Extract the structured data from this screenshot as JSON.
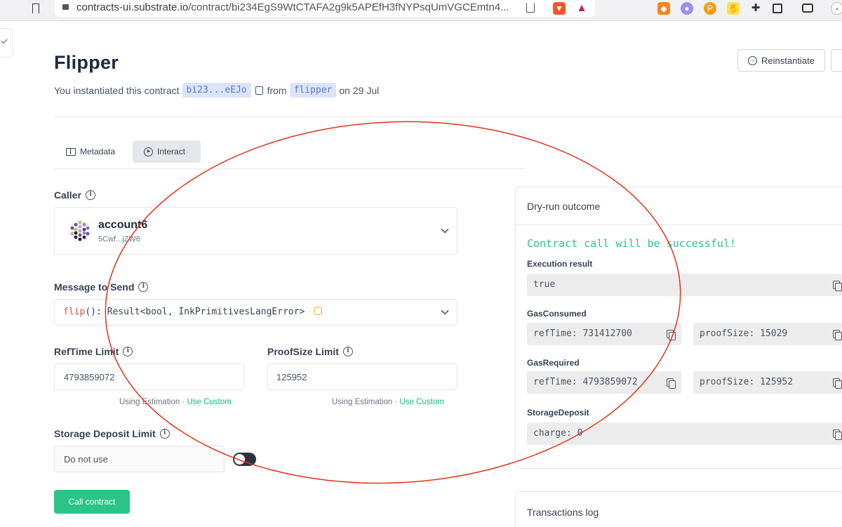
{
  "browser": {
    "url_host": "contracts-ui.substrate.io",
    "url_path": "/contract/bi234EgS9WtCTAFA2g9k5APEfH3fNYPsqUmVGCEmtn4..."
  },
  "header": {
    "title": "Flipper",
    "subtitle_prefix": "You instantiated this contract",
    "address_pill": "bi23...eEJo",
    "from_text": "from",
    "code_pill": "flipper",
    "date_text": "on 29 Jul",
    "reinstantiate_label": "Reinstantiate"
  },
  "tabs": [
    {
      "label": "Metadata",
      "icon": "book-icon"
    },
    {
      "label": "Interact",
      "icon": "play-circle-icon"
    }
  ],
  "active_tab": "Interact",
  "form": {
    "caller_label": "Caller",
    "account_name": "account6",
    "account_address": "5Cwf...jZW6",
    "message_label": "Message to Send",
    "message_fn": "flip",
    "message_sig": "(): Result<bool, InkPrimitivesLangError>",
    "reftime_label": "RefTime Limit",
    "reftime_value": "4793859072",
    "reftime_hint": "Using Estimation",
    "reftime_link": "Use Custom",
    "proofsize_label": "ProofSize Limit",
    "proofsize_value": "125952",
    "proofsize_hint": "Using Estimation",
    "proofsize_link": "Use Custom",
    "storage_label": "Storage Deposit Limit",
    "storage_value": "Do not use",
    "storage_toggle_on": false,
    "call_button": "Call contract"
  },
  "dry_run": {
    "title": "Dry-run outcome",
    "success_message": "Contract call will be successful!",
    "execution_label": "Execution result",
    "execution_value": "true",
    "gas_consumed_label": "GasConsumed",
    "gas_consumed_reftime": "refTime: 731412700",
    "gas_consumed_proofsize": "proofSize: 15029",
    "gas_required_label": "GasRequired",
    "gas_required_reftime": "refTime: 4793859072",
    "gas_required_proofsize": "proofSize: 125952",
    "storage_deposit_label": "StorageDeposit",
    "storage_deposit_value": "charge: 0"
  },
  "transactions_log": {
    "title": "Transactions log"
  },
  "colors": {
    "accent_green": "#2bc487",
    "pill_bg": "#dbe4f7",
    "annotation_red": "#e0321c"
  }
}
